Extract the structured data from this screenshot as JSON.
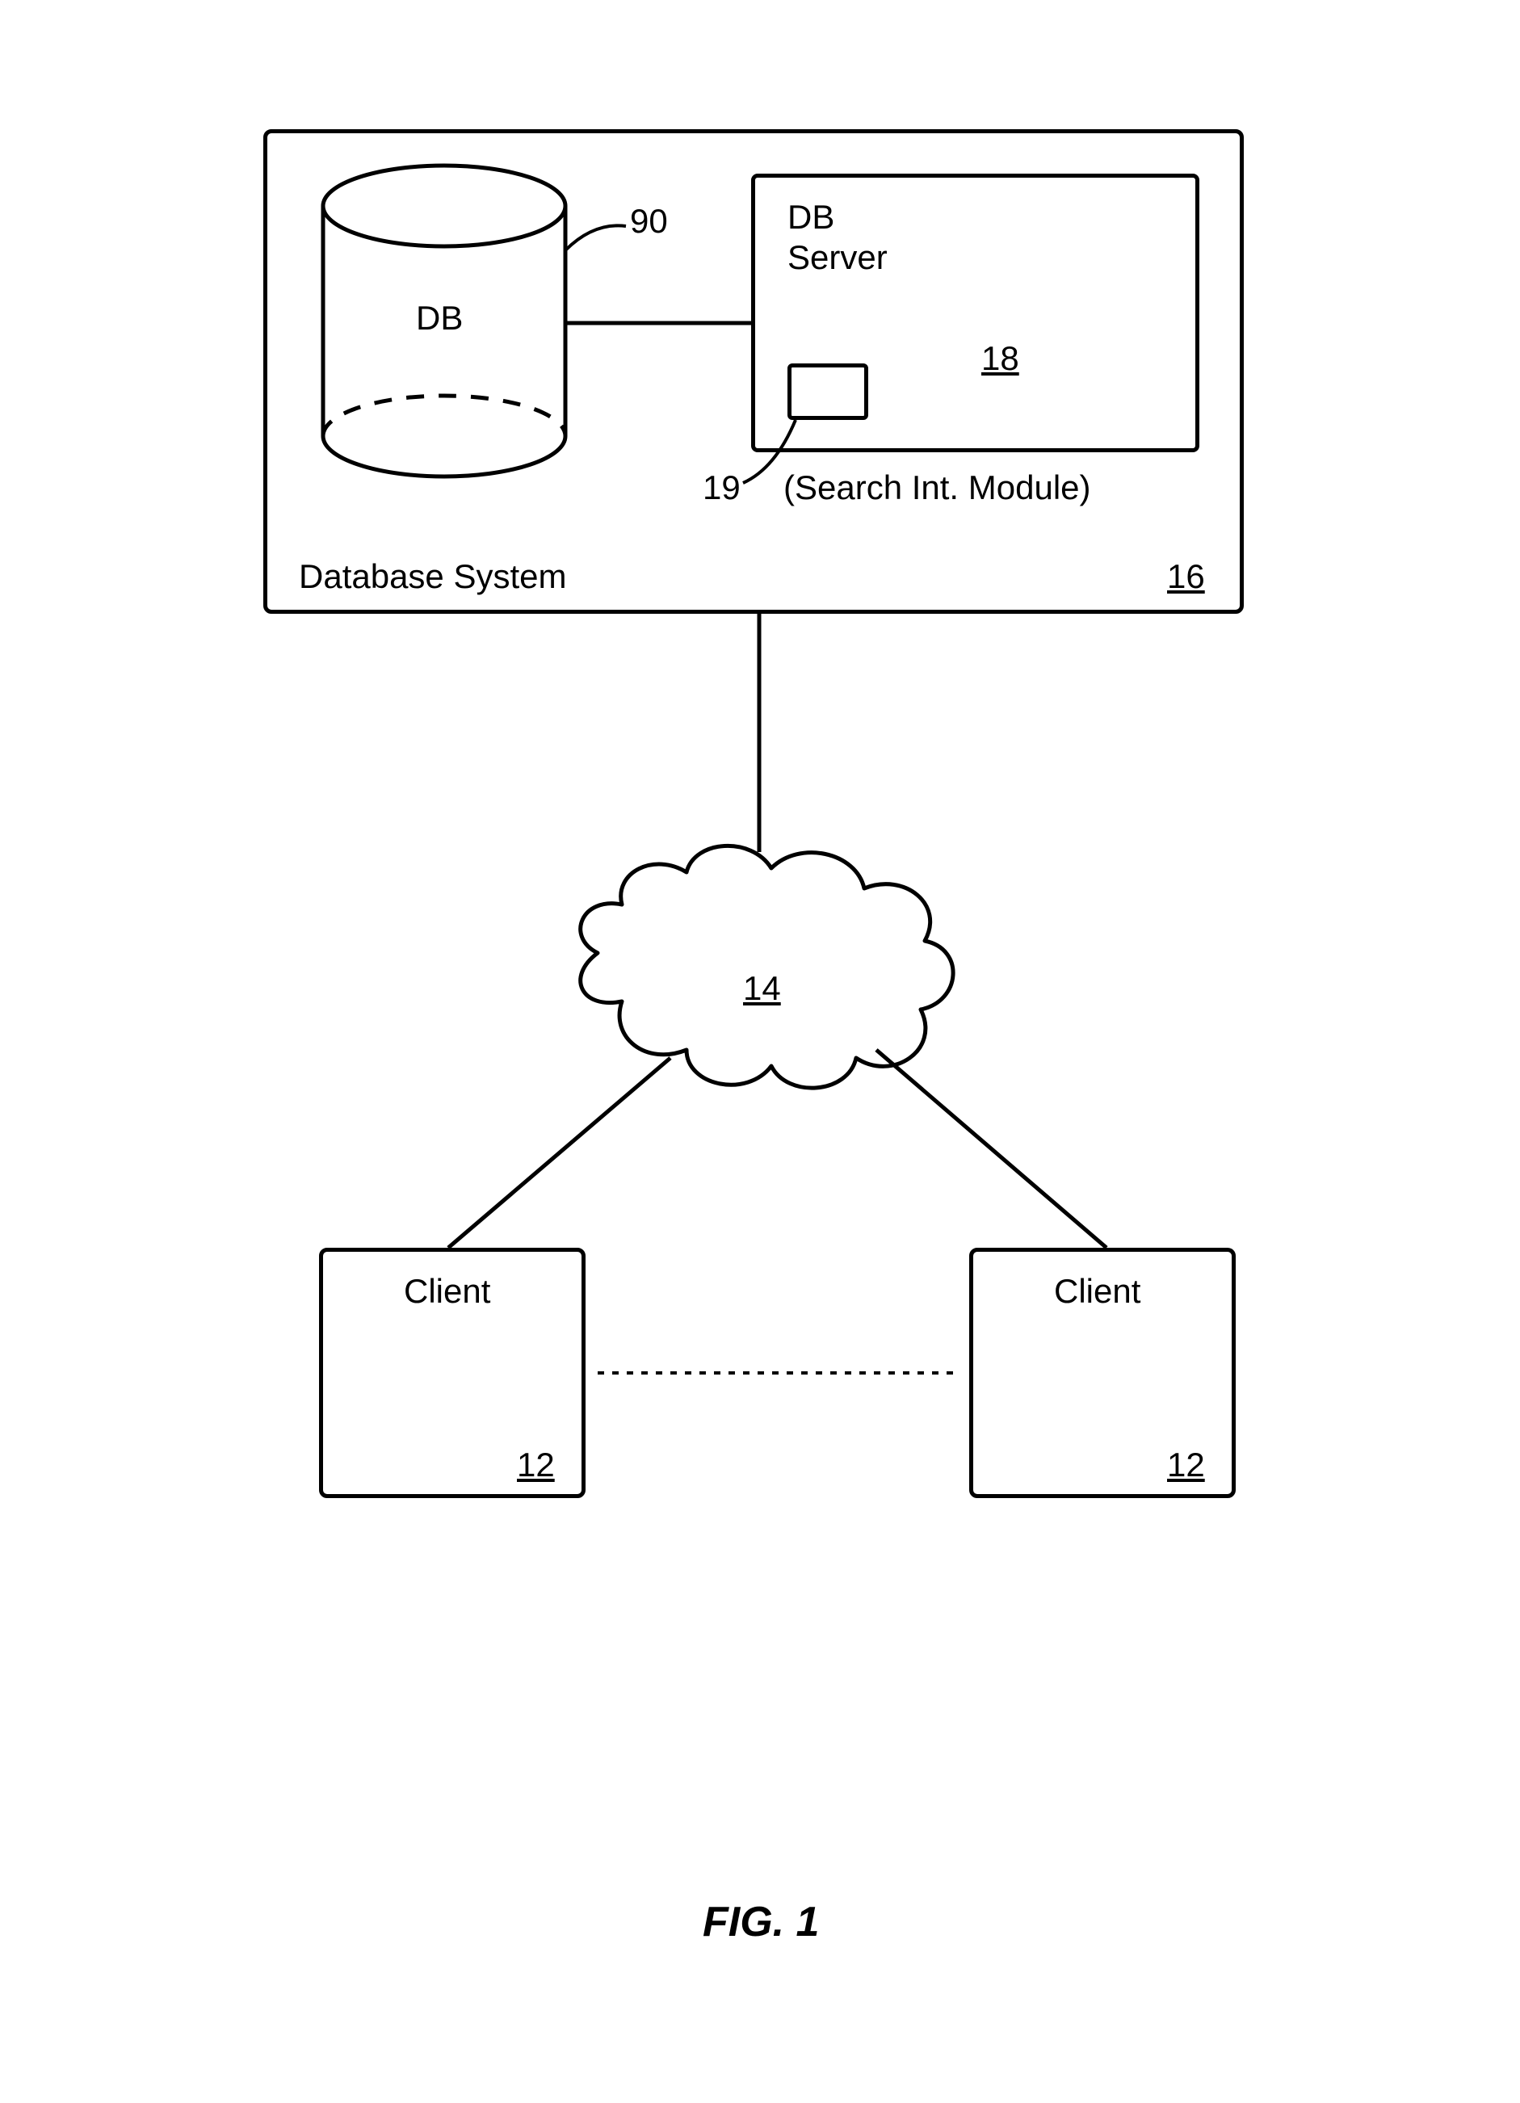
{
  "database_system": {
    "label": "Database System",
    "ref": "16",
    "db": {
      "label": "DB",
      "ref": "90"
    },
    "db_server": {
      "label1": "DB",
      "label2": "Server",
      "ref": "18",
      "module": {
        "ref": "19",
        "note": "(Search Int. Module)"
      }
    }
  },
  "network": {
    "ref": "14"
  },
  "clients": {
    "left": {
      "label": "Client",
      "ref": "12"
    },
    "right": {
      "label": "Client",
      "ref": "12"
    }
  },
  "figure_caption": "FIG. 1"
}
